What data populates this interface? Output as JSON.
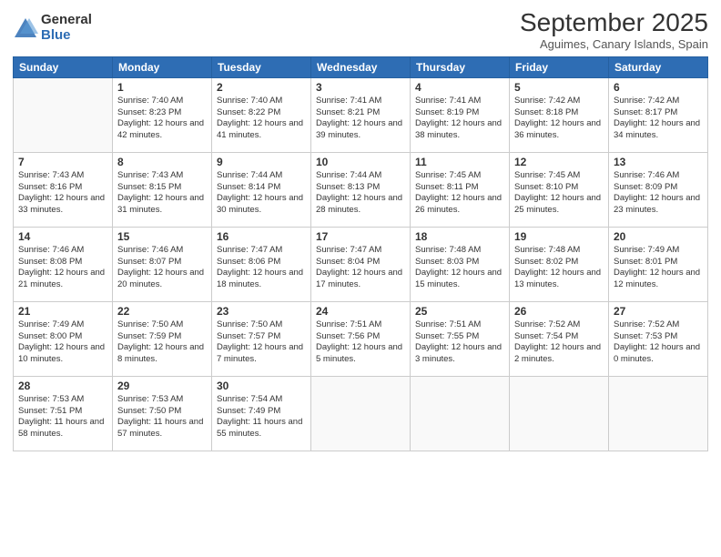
{
  "logo": {
    "general": "General",
    "blue": "Blue"
  },
  "title": "September 2025",
  "subtitle": "Aguimes, Canary Islands, Spain",
  "weekdays": [
    "Sunday",
    "Monday",
    "Tuesday",
    "Wednesday",
    "Thursday",
    "Friday",
    "Saturday"
  ],
  "weeks": [
    [
      {
        "day": "",
        "sunrise": "",
        "sunset": "",
        "daylight": ""
      },
      {
        "day": "1",
        "sunrise": "Sunrise: 7:40 AM",
        "sunset": "Sunset: 8:23 PM",
        "daylight": "Daylight: 12 hours and 42 minutes."
      },
      {
        "day": "2",
        "sunrise": "Sunrise: 7:40 AM",
        "sunset": "Sunset: 8:22 PM",
        "daylight": "Daylight: 12 hours and 41 minutes."
      },
      {
        "day": "3",
        "sunrise": "Sunrise: 7:41 AM",
        "sunset": "Sunset: 8:21 PM",
        "daylight": "Daylight: 12 hours and 39 minutes."
      },
      {
        "day": "4",
        "sunrise": "Sunrise: 7:41 AM",
        "sunset": "Sunset: 8:19 PM",
        "daylight": "Daylight: 12 hours and 38 minutes."
      },
      {
        "day": "5",
        "sunrise": "Sunrise: 7:42 AM",
        "sunset": "Sunset: 8:18 PM",
        "daylight": "Daylight: 12 hours and 36 minutes."
      },
      {
        "day": "6",
        "sunrise": "Sunrise: 7:42 AM",
        "sunset": "Sunset: 8:17 PM",
        "daylight": "Daylight: 12 hours and 34 minutes."
      }
    ],
    [
      {
        "day": "7",
        "sunrise": "Sunrise: 7:43 AM",
        "sunset": "Sunset: 8:16 PM",
        "daylight": "Daylight: 12 hours and 33 minutes."
      },
      {
        "day": "8",
        "sunrise": "Sunrise: 7:43 AM",
        "sunset": "Sunset: 8:15 PM",
        "daylight": "Daylight: 12 hours and 31 minutes."
      },
      {
        "day": "9",
        "sunrise": "Sunrise: 7:44 AM",
        "sunset": "Sunset: 8:14 PM",
        "daylight": "Daylight: 12 hours and 30 minutes."
      },
      {
        "day": "10",
        "sunrise": "Sunrise: 7:44 AM",
        "sunset": "Sunset: 8:13 PM",
        "daylight": "Daylight: 12 hours and 28 minutes."
      },
      {
        "day": "11",
        "sunrise": "Sunrise: 7:45 AM",
        "sunset": "Sunset: 8:11 PM",
        "daylight": "Daylight: 12 hours and 26 minutes."
      },
      {
        "day": "12",
        "sunrise": "Sunrise: 7:45 AM",
        "sunset": "Sunset: 8:10 PM",
        "daylight": "Daylight: 12 hours and 25 minutes."
      },
      {
        "day": "13",
        "sunrise": "Sunrise: 7:46 AM",
        "sunset": "Sunset: 8:09 PM",
        "daylight": "Daylight: 12 hours and 23 minutes."
      }
    ],
    [
      {
        "day": "14",
        "sunrise": "Sunrise: 7:46 AM",
        "sunset": "Sunset: 8:08 PM",
        "daylight": "Daylight: 12 hours and 21 minutes."
      },
      {
        "day": "15",
        "sunrise": "Sunrise: 7:46 AM",
        "sunset": "Sunset: 8:07 PM",
        "daylight": "Daylight: 12 hours and 20 minutes."
      },
      {
        "day": "16",
        "sunrise": "Sunrise: 7:47 AM",
        "sunset": "Sunset: 8:06 PM",
        "daylight": "Daylight: 12 hours and 18 minutes."
      },
      {
        "day": "17",
        "sunrise": "Sunrise: 7:47 AM",
        "sunset": "Sunset: 8:04 PM",
        "daylight": "Daylight: 12 hours and 17 minutes."
      },
      {
        "day": "18",
        "sunrise": "Sunrise: 7:48 AM",
        "sunset": "Sunset: 8:03 PM",
        "daylight": "Daylight: 12 hours and 15 minutes."
      },
      {
        "day": "19",
        "sunrise": "Sunrise: 7:48 AM",
        "sunset": "Sunset: 8:02 PM",
        "daylight": "Daylight: 12 hours and 13 minutes."
      },
      {
        "day": "20",
        "sunrise": "Sunrise: 7:49 AM",
        "sunset": "Sunset: 8:01 PM",
        "daylight": "Daylight: 12 hours and 12 minutes."
      }
    ],
    [
      {
        "day": "21",
        "sunrise": "Sunrise: 7:49 AM",
        "sunset": "Sunset: 8:00 PM",
        "daylight": "Daylight: 12 hours and 10 minutes."
      },
      {
        "day": "22",
        "sunrise": "Sunrise: 7:50 AM",
        "sunset": "Sunset: 7:59 PM",
        "daylight": "Daylight: 12 hours and 8 minutes."
      },
      {
        "day": "23",
        "sunrise": "Sunrise: 7:50 AM",
        "sunset": "Sunset: 7:57 PM",
        "daylight": "Daylight: 12 hours and 7 minutes."
      },
      {
        "day": "24",
        "sunrise": "Sunrise: 7:51 AM",
        "sunset": "Sunset: 7:56 PM",
        "daylight": "Daylight: 12 hours and 5 minutes."
      },
      {
        "day": "25",
        "sunrise": "Sunrise: 7:51 AM",
        "sunset": "Sunset: 7:55 PM",
        "daylight": "Daylight: 12 hours and 3 minutes."
      },
      {
        "day": "26",
        "sunrise": "Sunrise: 7:52 AM",
        "sunset": "Sunset: 7:54 PM",
        "daylight": "Daylight: 12 hours and 2 minutes."
      },
      {
        "day": "27",
        "sunrise": "Sunrise: 7:52 AM",
        "sunset": "Sunset: 7:53 PM",
        "daylight": "Daylight: 12 hours and 0 minutes."
      }
    ],
    [
      {
        "day": "28",
        "sunrise": "Sunrise: 7:53 AM",
        "sunset": "Sunset: 7:51 PM",
        "daylight": "Daylight: 11 hours and 58 minutes."
      },
      {
        "day": "29",
        "sunrise": "Sunrise: 7:53 AM",
        "sunset": "Sunset: 7:50 PM",
        "daylight": "Daylight: 11 hours and 57 minutes."
      },
      {
        "day": "30",
        "sunrise": "Sunrise: 7:54 AM",
        "sunset": "Sunset: 7:49 PM",
        "daylight": "Daylight: 11 hours and 55 minutes."
      },
      {
        "day": "",
        "sunrise": "",
        "sunset": "",
        "daylight": ""
      },
      {
        "day": "",
        "sunrise": "",
        "sunset": "",
        "daylight": ""
      },
      {
        "day": "",
        "sunrise": "",
        "sunset": "",
        "daylight": ""
      },
      {
        "day": "",
        "sunrise": "",
        "sunset": "",
        "daylight": ""
      }
    ]
  ]
}
